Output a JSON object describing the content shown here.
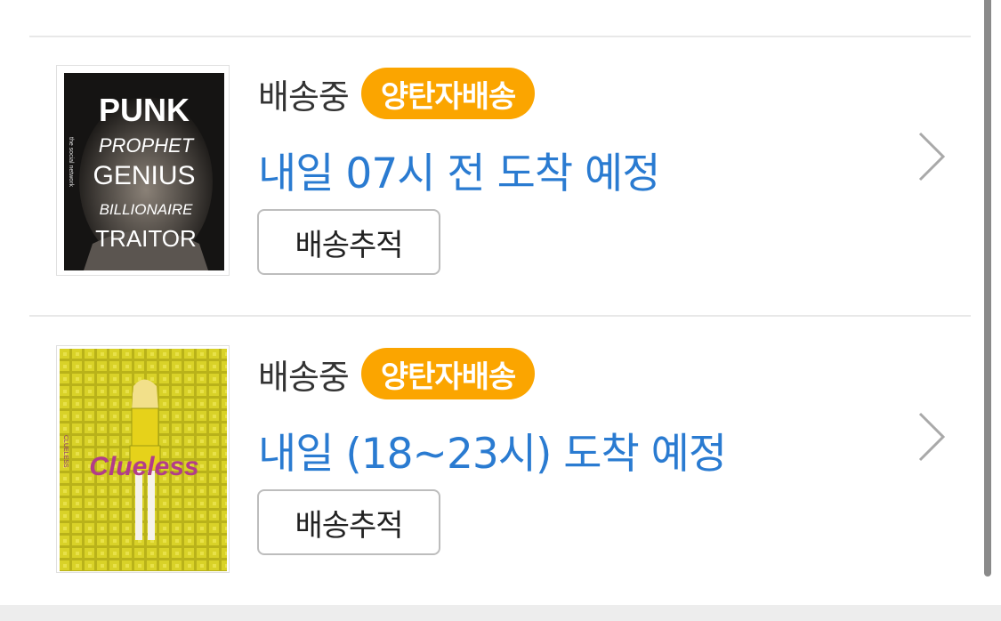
{
  "items": [
    {
      "status": "배송중",
      "badge": "양탄자배송",
      "eta": "내일 07시 전 도착 예정",
      "track_label": "배송추적",
      "cover": {
        "lines": [
          "PUNK",
          "PROPHET",
          "GENIUS",
          "BILLIONAIRE",
          "TRAITOR"
        ],
        "side_text": "the social network"
      }
    },
    {
      "status": "배송중",
      "badge": "양탄자배송",
      "eta": "내일 (18~23시) 도착 예정",
      "track_label": "배송추적",
      "cover": {
        "title": "Clueless",
        "side_text": "CLUELESS"
      }
    }
  ],
  "colors": {
    "badge": "#fba500",
    "eta": "#2a7bd1"
  },
  "icons": [
    "chevron-right-icon"
  ]
}
